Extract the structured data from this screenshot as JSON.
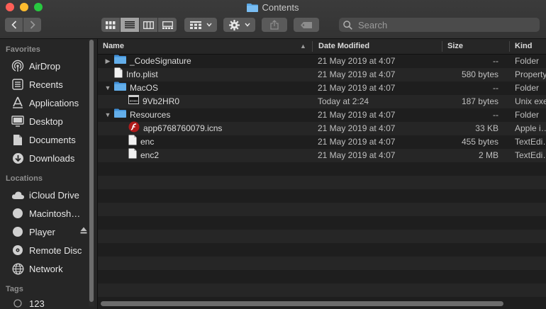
{
  "window": {
    "title": "Contents"
  },
  "toolbar": {
    "search_placeholder": "Search"
  },
  "sidebar": {
    "favorites_heading": "Favorites",
    "favorites": [
      {
        "label": "AirDrop",
        "icon": "airdrop-icon"
      },
      {
        "label": "Recents",
        "icon": "recents-icon"
      },
      {
        "label": "Applications",
        "icon": "applications-icon"
      },
      {
        "label": "Desktop",
        "icon": "desktop-icon"
      },
      {
        "label": "Documents",
        "icon": "documents-icon"
      },
      {
        "label": "Downloads",
        "icon": "downloads-icon"
      }
    ],
    "locations_heading": "Locations",
    "locations": [
      {
        "label": "iCloud Drive",
        "icon": "cloud-icon"
      },
      {
        "label": "Macintosh…",
        "icon": "disk-icon"
      },
      {
        "label": "Player",
        "icon": "disk-icon"
      },
      {
        "label": "Remote Disc",
        "icon": "disc-icon"
      },
      {
        "label": "Network",
        "icon": "network-icon"
      }
    ],
    "tags_heading": "Tags",
    "tags": [
      {
        "label": "123"
      }
    ]
  },
  "columns": {
    "name": "Name",
    "date": "Date Modified",
    "size": "Size",
    "kind": "Kind"
  },
  "files": [
    {
      "name": "_CodeSignature",
      "date": "21 May 2019 at 4:07",
      "size": "--",
      "kind": "Folder",
      "icon": "folder",
      "indent": 0,
      "disclosure": "collapsed"
    },
    {
      "name": "Info.plist",
      "date": "21 May 2019 at 4:07",
      "size": "580 bytes",
      "kind": "Property",
      "icon": "document",
      "indent": 0,
      "disclosure": "none"
    },
    {
      "name": "MacOS",
      "date": "21 May 2019 at 4:07",
      "size": "--",
      "kind": "Folder",
      "icon": "folder",
      "indent": 0,
      "disclosure": "expanded"
    },
    {
      "name": "9Vb2HR0",
      "date": "Today at 2:24",
      "size": "187 bytes",
      "kind": "Unix exe",
      "icon": "terminal",
      "indent": 1,
      "disclosure": "none"
    },
    {
      "name": "Resources",
      "date": "21 May 2019 at 4:07",
      "size": "--",
      "kind": "Folder",
      "icon": "folder",
      "indent": 0,
      "disclosure": "expanded"
    },
    {
      "name": "app6768760079.icns",
      "date": "21 May 2019 at 4:07",
      "size": "33 KB",
      "kind": "Apple i…",
      "icon": "flash",
      "indent": 1,
      "disclosure": "none"
    },
    {
      "name": "enc",
      "date": "21 May 2019 at 4:07",
      "size": "455 bytes",
      "kind": "TextEdi…",
      "icon": "document",
      "indent": 1,
      "disclosure": "none"
    },
    {
      "name": "enc2",
      "date": "21 May 2019 at 4:07",
      "size": "2 MB",
      "kind": "TextEdi…",
      "icon": "document",
      "indent": 1,
      "disclosure": "none"
    }
  ]
}
